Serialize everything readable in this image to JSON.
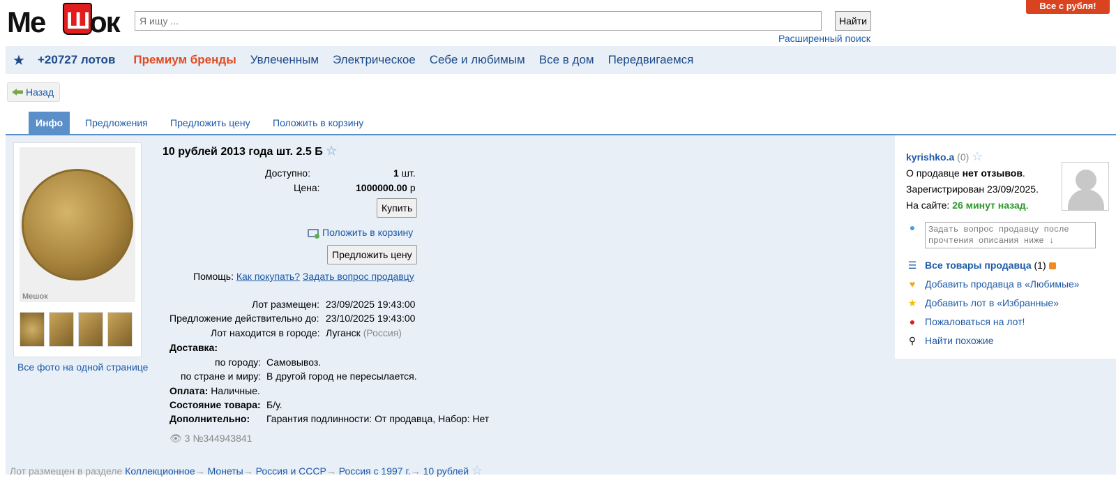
{
  "header": {
    "logo_left": "Ме",
    "logo_bag": "Ш",
    "logo_right": "ок",
    "search_placeholder": "Я ищу ...",
    "search_button": "Найти",
    "advanced_search": "Расширенный поиск",
    "promo": "Все с рубля!"
  },
  "nav": {
    "lots": "+20727 лотов",
    "premium": "Премиум бренды",
    "items": [
      "Увлеченным",
      "Электрическое",
      "Себе и любимым",
      "Все в дом",
      "Передвигаемся"
    ]
  },
  "back_label": "Назад",
  "tabs": [
    "Инфо",
    "Предложения",
    "Предложить цену",
    "Положить в корзину"
  ],
  "photos": {
    "watermark": "Мешок",
    "all_photos_link": "Все фото на одной странице"
  },
  "lot": {
    "title": "10 рублей 2013 года шт. 2.5 Б",
    "available_label": "Доступно:",
    "available_value": "1",
    "available_unit": "шт.",
    "price_label": "Цена:",
    "price_value": "1000000.00",
    "price_unit": "р",
    "buy_button": "Купить",
    "add_to_cart": "Положить в корзину",
    "offer_price_button": "Предложить цену",
    "help_label": "Помощь:",
    "help_how": "Как покупать?",
    "help_ask": "Задать вопрос продавцу",
    "placed_label": "Лот размещен:",
    "placed_value": "23/09/2025 19:43:00",
    "valid_label": "Предложение действительно до:",
    "valid_value": "23/10/2025 19:43:00",
    "city_label": "Лот находится в городе:",
    "city_value": "Луганск",
    "country": "(Россия)",
    "delivery_label": "Доставка:",
    "city_delivery_label": "по городу:",
    "city_delivery_value": "Самовывоз.",
    "world_delivery_label": "по стране и миру:",
    "world_delivery_value": "В другой город не пересылается.",
    "payment_label": "Оплата:",
    "payment_value": "Наличные.",
    "condition_label": "Состояние товара:",
    "condition_value": "Б/у.",
    "extra_label": "Дополнительно:",
    "extra_value": "Гарантия подлинности: От продавца, Набор: Нет",
    "views": "3",
    "lot_number": "№344943841"
  },
  "seller": {
    "name": "kyrishko.a",
    "rating": "(0)",
    "reviews_prefix": "О продавце",
    "reviews_value": "нет отзывов",
    "registered": "Зарегистрирован 23/09/2025.",
    "online_label": "На сайте:",
    "online_value": "26 минут назад",
    "ask_placeholder": "Задать вопрос продавцу после прочтения описания ниже ↓",
    "all_items": "Все товары продавца",
    "all_items_count": "(1)",
    "add_favorite_seller": "Добавить продавца в «Любимые»",
    "add_favorite_lot": "Добавить лот в «Избранные»",
    "complain": "Пожаловаться на лот!",
    "find_similar": "Найти похожие"
  },
  "breadcrumb": {
    "prefix": "Лот размещен в разделе",
    "items": [
      "Коллекционное",
      "Монеты",
      "Россия и СССР",
      "Россия с 1997 г.",
      "10 рублей"
    ]
  }
}
